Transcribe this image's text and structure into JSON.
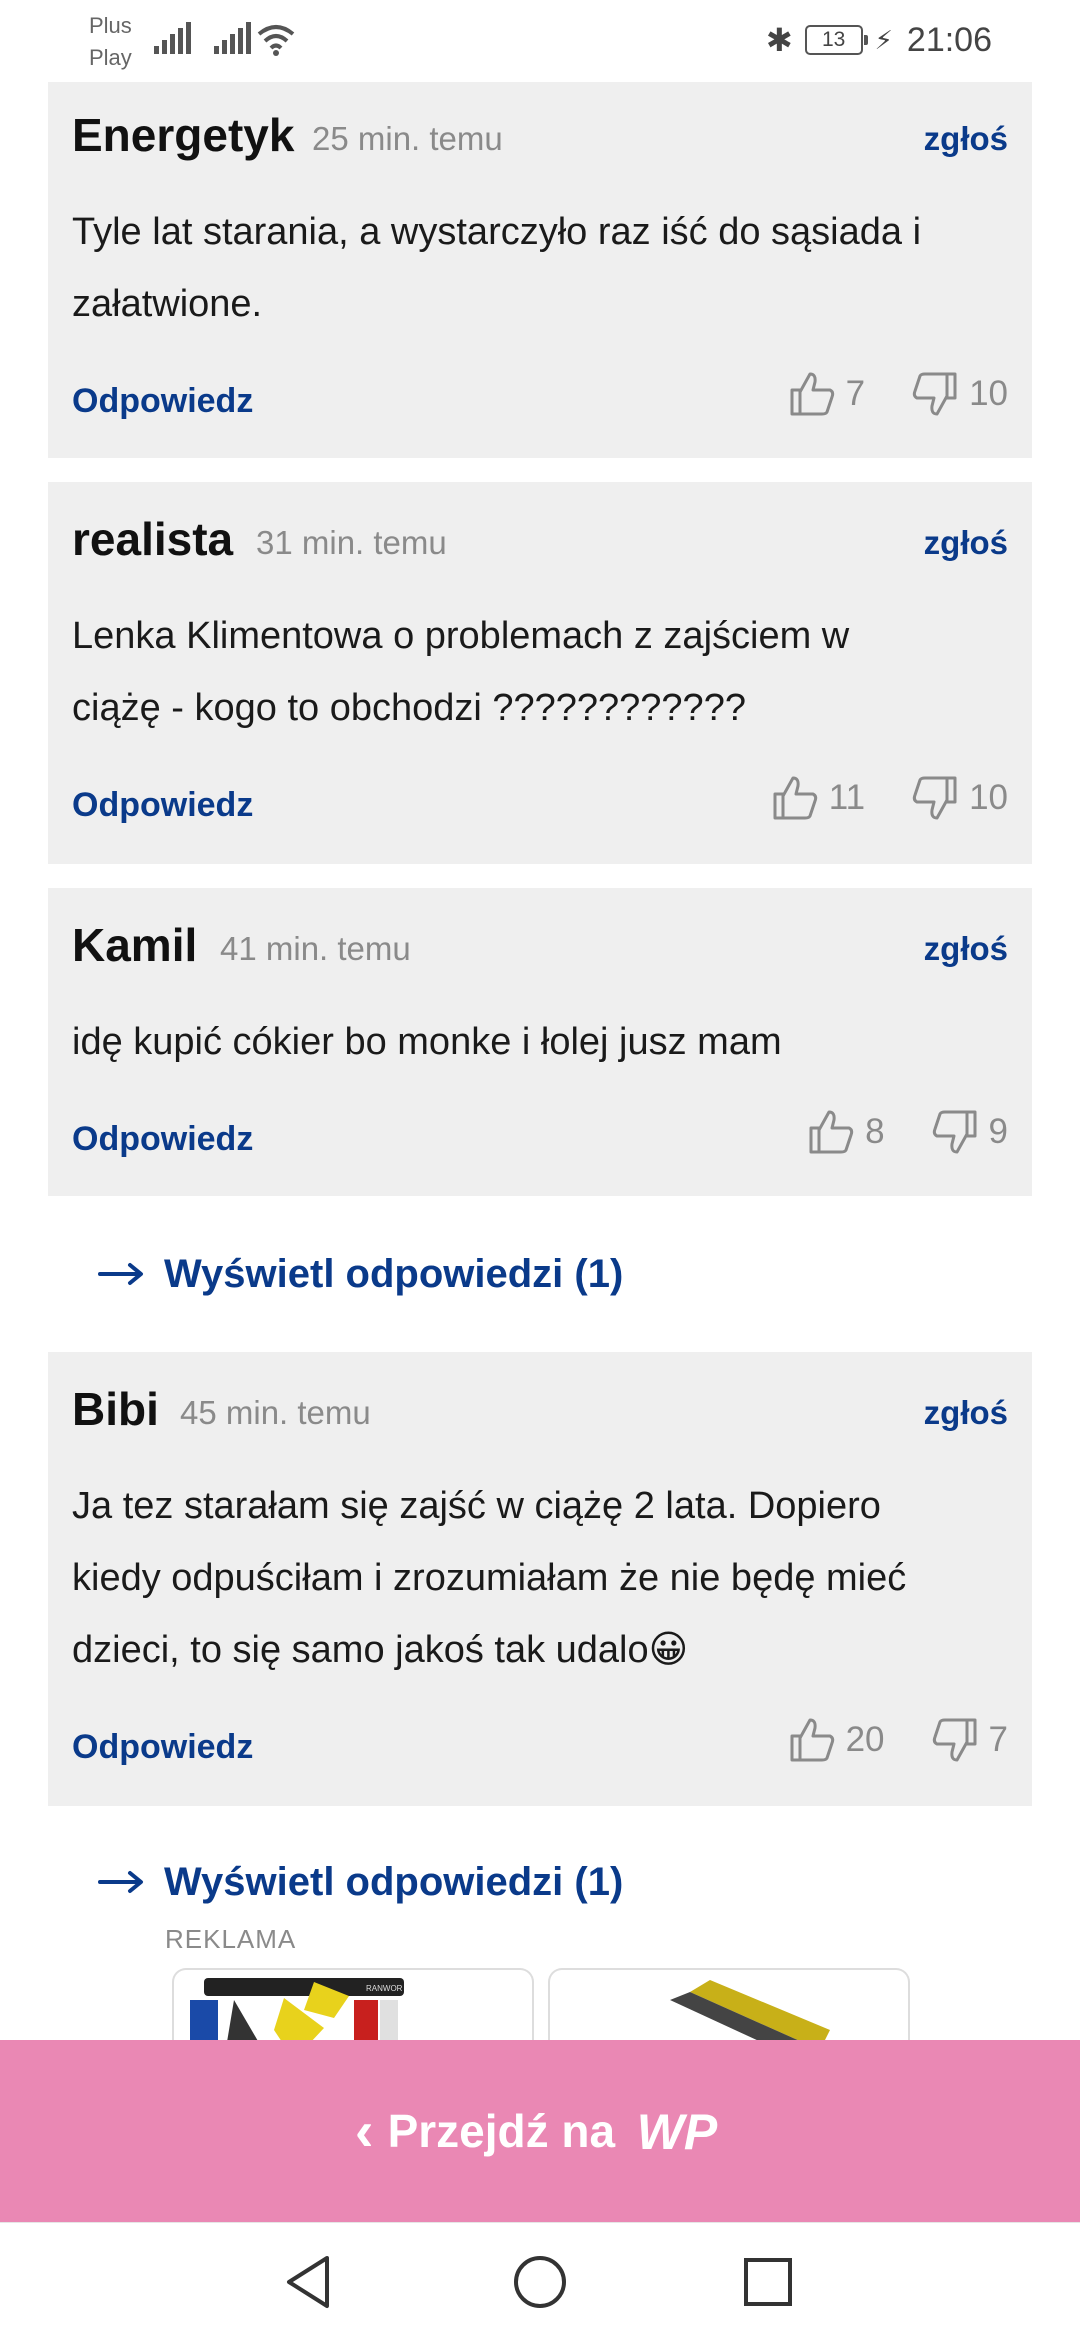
{
  "status_bar": {
    "carrier_1": "Plus",
    "carrier_2": "Play",
    "battery": "13",
    "time": "21:06"
  },
  "comments": [
    {
      "author": "Energetyk",
      "time": "25 min. temu",
      "report": "zgłoś",
      "lines": [
        "Tyle lat starania, a wystarczyło raz iść do sąsiada i",
        "załatwione."
      ],
      "reply": "Odpowiedz",
      "likes": "7",
      "dislikes": "10"
    },
    {
      "author": "realista",
      "time": "31 min. temu",
      "report": "zgłoś",
      "lines": [
        "Lenka Klimentowa o problemach z zajściem w",
        "ciążę - kogo to obchodzi ????????????"
      ],
      "reply": "Odpowiedz",
      "likes": "11",
      "dislikes": "10"
    },
    {
      "author": "Kamil",
      "time": "41 min. temu",
      "report": "zgłoś",
      "lines": [
        "idę kupić cókier bo monke i łolej jusz mam"
      ],
      "reply": "Odpowiedz",
      "likes": "8",
      "dislikes": "9"
    },
    {
      "author": "Bibi",
      "time": "45 min. temu",
      "report": "zgłoś",
      "lines": [
        "Ja tez starałam się zajść w ciążę 2 lata. Dopiero",
        "kiedy odpuściłam i zrozumiałam że nie będę mieć",
        "dzieci, to się samo jakoś tak udalo😀"
      ],
      "reply": "Odpowiedz",
      "likes": "20",
      "dislikes": "7"
    }
  ],
  "show_replies": [
    "Wyświetl odpowiedzi (1)",
    "Wyświetl odpowiedzi (1)"
  ],
  "ad": {
    "label": "REKLAMA",
    "brand": "RANWOR"
  },
  "banner": {
    "label": "Przejdź na",
    "logo": "WP"
  },
  "icons": {
    "like": "thumbs-up-icon",
    "dislike": "thumbs-down-icon",
    "arrow": "arrow-right-icon",
    "back": "nav-back-icon",
    "home": "nav-home-icon",
    "recents": "nav-recents-icon"
  },
  "colors": {
    "link": "#0a3a8a",
    "card": "#efefef",
    "banner": "#ea88b4",
    "muted": "#8a8a8a"
  }
}
